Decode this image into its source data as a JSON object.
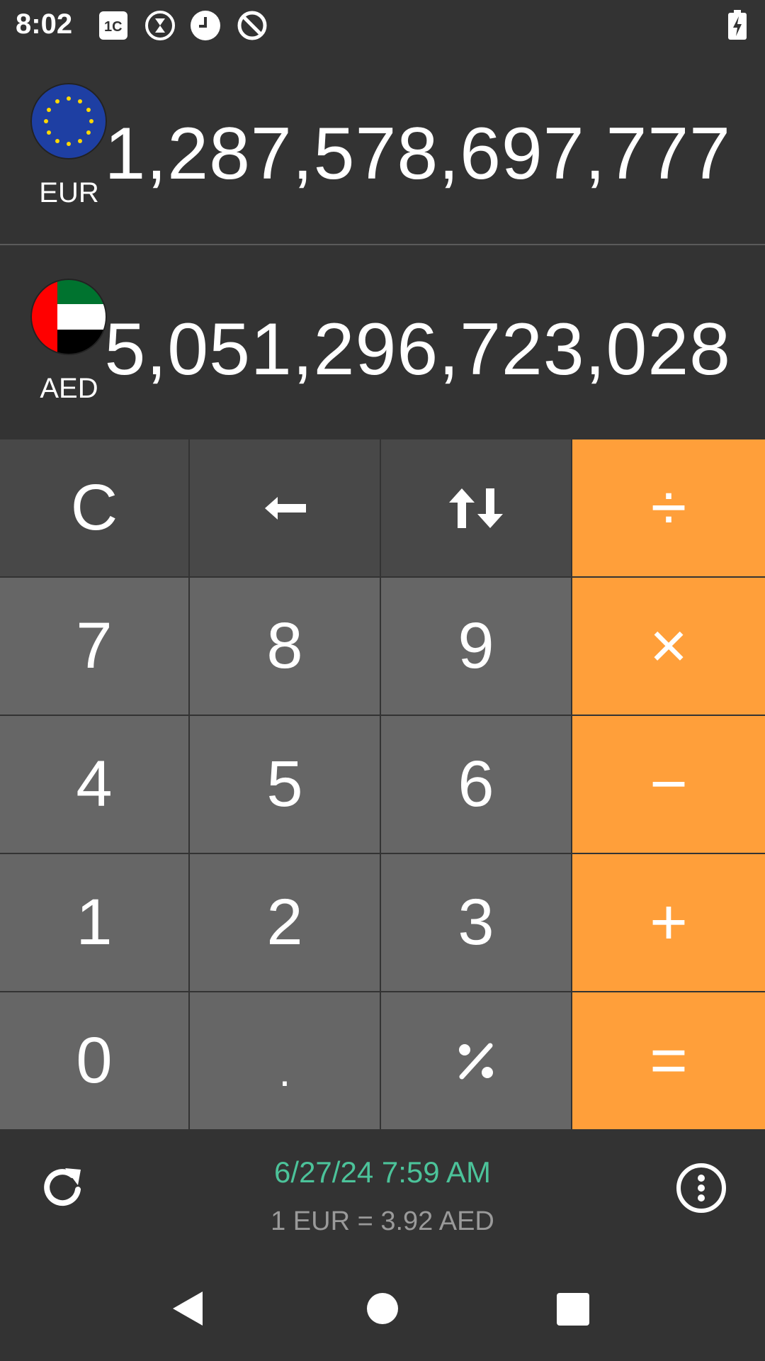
{
  "status_bar": {
    "time": "8:02",
    "icons": [
      "app-1c-icon",
      "hourglass-icon",
      "clock-icon",
      "do-not-disturb-icon"
    ],
    "battery": "battery-charging-icon"
  },
  "from_currency": {
    "code": "EUR",
    "flag": "eu-flag-icon",
    "amount": "1,287,578,697,777"
  },
  "to_currency": {
    "code": "AED",
    "flag": "uae-flag-icon",
    "amount": "5,051,296,723,028"
  },
  "keypad": {
    "clear": "C",
    "seven": "7",
    "eight": "8",
    "nine": "9",
    "four": "4",
    "five": "5",
    "six": "6",
    "one": "1",
    "two": "2",
    "three": "3",
    "zero": "0",
    "dot": ".",
    "divide": "÷",
    "multiply": "×",
    "minus": "−",
    "plus": "+",
    "equals": "="
  },
  "info": {
    "updated": "6/27/24 7:59 AM",
    "rate": "1 EUR = 3.92 AED"
  },
  "colors": {
    "background": "#333333",
    "digit_key": "#666666",
    "function_key": "#484848",
    "operator_key": "#ff9f3a",
    "date_text": "#4cc39a",
    "rate_text": "#9a9a9a"
  }
}
